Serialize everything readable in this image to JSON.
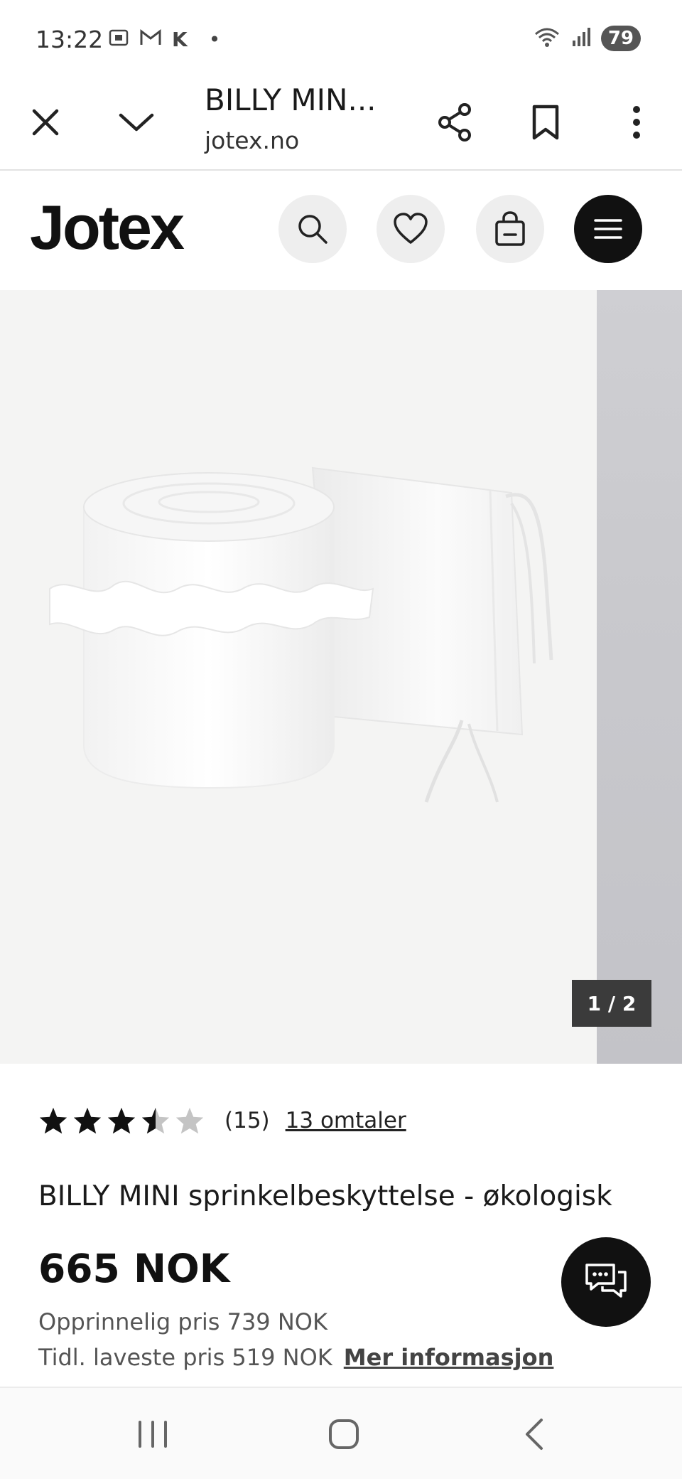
{
  "status_bar": {
    "time": "13:22",
    "left_icons": [
      "screenshot-icon",
      "gmail-icon",
      "k-icon",
      "dot-icon"
    ],
    "k_label": "K",
    "dot": "•",
    "battery": "79"
  },
  "browser": {
    "page_title": "BILLY MINI sprinkelbeskyttelse - økologisk",
    "page_title_display": "BILLY MIN...",
    "domain": "jotex.no"
  },
  "site_header": {
    "logo": "Jotex"
  },
  "gallery": {
    "counter": "1 / 2",
    "current": 1,
    "total": 2
  },
  "product": {
    "rating_value": 3.5,
    "rating_max": 5,
    "rating_count": "(15)",
    "reviews_link": "13 omtaler",
    "name": "BILLY MINI sprinkelbeskyttelse - økologisk",
    "price": "665 NOK",
    "original_price": "Opprinnelig pris 739 NOK",
    "lowest_price": "Tidl. laveste pris 519 NOK",
    "more_info": "Mer informasjon"
  },
  "colors": {
    "brand_dark": "#111111",
    "gallery_bg": "#f4f4f3",
    "icon_button_bg": "#eeeeee"
  }
}
